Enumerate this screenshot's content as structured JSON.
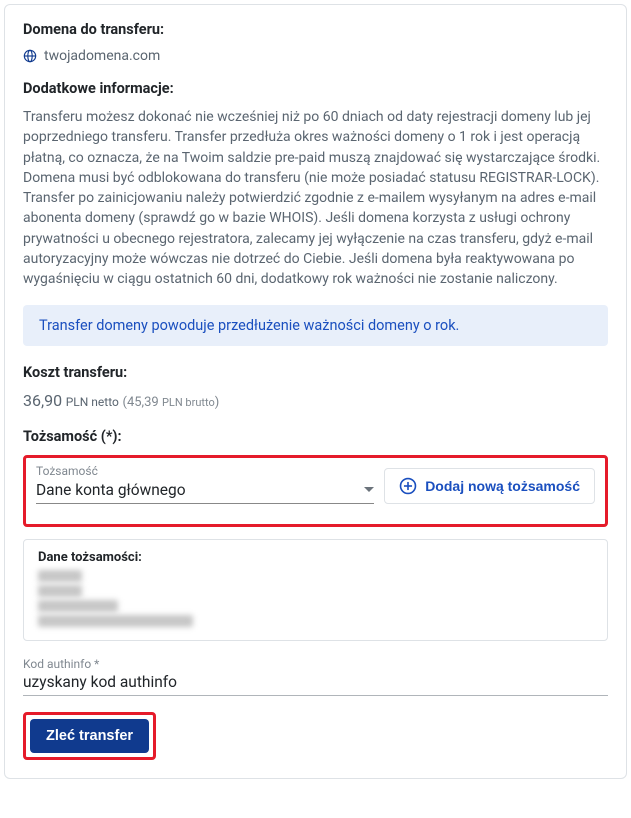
{
  "domain_section": {
    "label": "Domena do transferu:",
    "value": "twojadomena.com"
  },
  "info_section": {
    "label": "Dodatkowe informacje:",
    "text": "Transferu możesz dokonać nie wcześniej niż po 60 dniach od daty rejestracji domeny lub jej poprzedniego transferu. Transfer przedłuża okres ważności domeny o 1 rok i jest operacją płatną, co oznacza, że na Twoim saldzie pre-paid muszą znajdować się wystarczające środki. Domena musi być odblokowana do transferu (nie może posiadać statusu REGISTRAR-LOCK). Transfer po zainicjowaniu należy potwierdzić zgodnie z e-mailem wysyłanym na adres e-mail abonenta domeny (sprawdź go w bazie WHOIS). Jeśli domena korzysta z usługi ochrony prywatności u obecnego rejestratora, zalecamy jej wyłączenie na czas transferu, gdyż e-mail autoryzacyjny może wówczas nie dotrzeć do Ciebie. Jeśli domena była reaktywowana po wygaśnięciu w ciągu ostatnich 60 dni, dodatkowy rok ważności nie zostanie naliczony."
  },
  "notice": "Transfer domeny powoduje przedłużenie ważności domeny o rok.",
  "cost": {
    "label": "Koszt transferu:",
    "net_value": "36,90",
    "net_currency_label": "PLN netto",
    "gross_value": "45,39",
    "gross_currency_label": "PLN brutto"
  },
  "identity_section": {
    "header": "Tożsamość (*):",
    "select_label": "Tożsamość",
    "select_value": "Dane konta głównego",
    "add_button": "Dodaj nową tożsamość",
    "data_label": "Dane tożsamości:"
  },
  "authinfo": {
    "label": "Kod authinfo *",
    "value": "uzyskany kod authinfo"
  },
  "submit": "Zleć transfer"
}
